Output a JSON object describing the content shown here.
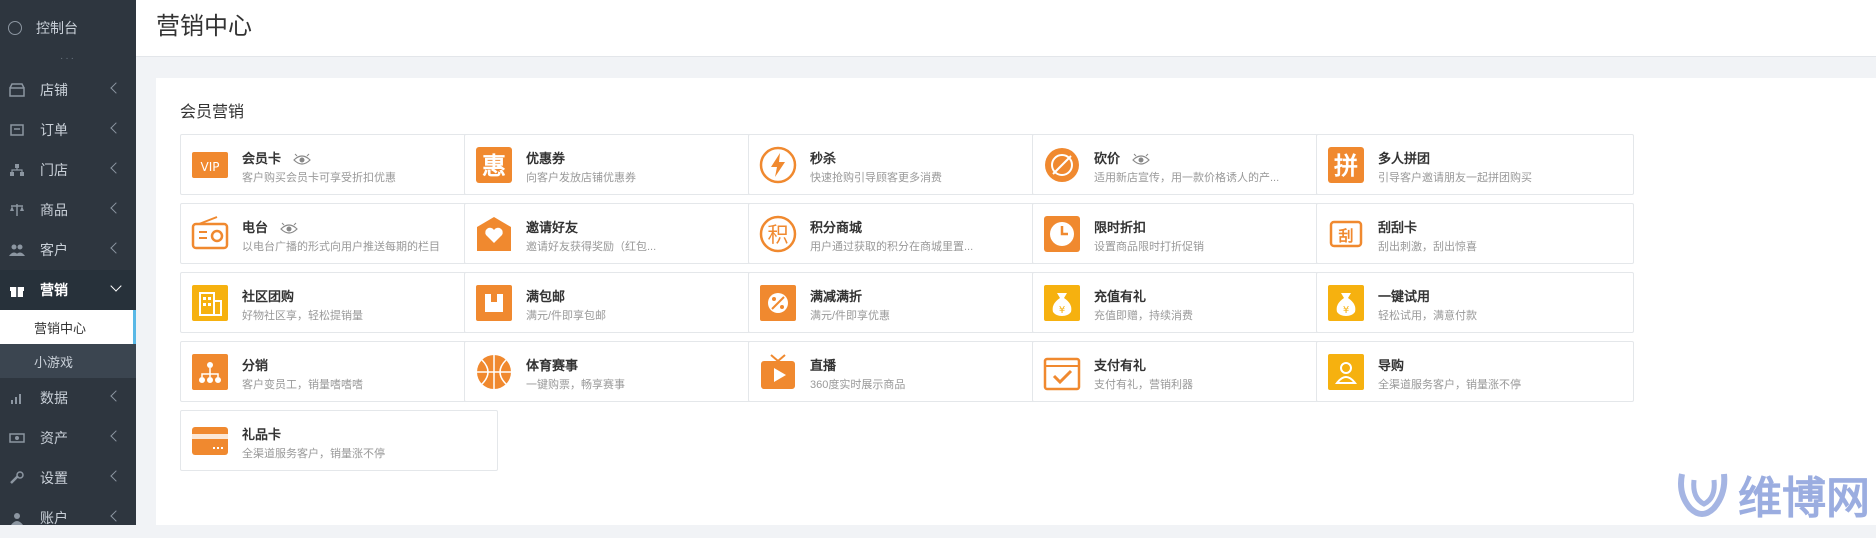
{
  "sidebar": {
    "dashboard": "控制台",
    "dots": "···",
    "items": [
      {
        "label": "店铺",
        "icon": "store-icon"
      },
      {
        "label": "订单",
        "icon": "order-icon"
      },
      {
        "label": "门店",
        "icon": "branch-icon"
      },
      {
        "label": "商品",
        "icon": "scale-icon"
      },
      {
        "label": "客户",
        "icon": "users-icon"
      },
      {
        "label": "营销",
        "icon": "gift-icon",
        "active": true
      },
      {
        "label": "数据",
        "icon": "bar-chart-icon"
      },
      {
        "label": "资产",
        "icon": "money-icon"
      },
      {
        "label": "设置",
        "icon": "wrench-icon"
      },
      {
        "label": "账户",
        "icon": "account-icon"
      }
    ],
    "submenu": [
      "营销中心",
      "小游戏"
    ]
  },
  "header": {
    "title": "营销中心"
  },
  "section": {
    "title": "会员营销"
  },
  "cards": [
    {
      "title": "会员卡",
      "desc": "客户购买会员卡可享受折扣优惠",
      "icon": "vip-icon",
      "eye": true
    },
    {
      "title": "优惠券",
      "desc": "向客户发放店铺优惠券",
      "icon": "coupon-icon",
      "glyph": "惠"
    },
    {
      "title": "秒杀",
      "desc": "快速抢购引导顾客更多消费",
      "icon": "lightning-icon"
    },
    {
      "title": "砍价",
      "desc": "适用新店宣传，用一款价格诱人的产...",
      "icon": "bargain-icon",
      "eye": true
    },
    {
      "title": "多人拼团",
      "desc": "引导客户邀请朋友一起拼团购买",
      "icon": "group-buy-icon",
      "glyph": "拼"
    },
    {
      "title": "电台",
      "desc": "以电台广播的形式向用户推送每期的栏目",
      "icon": "radio-icon",
      "eye": true
    },
    {
      "title": "邀请好友",
      "desc": "邀请好友获得奖励（红包...",
      "icon": "invite-icon"
    },
    {
      "title": "积分商城",
      "desc": "用户通过获取的积分在商城里置...",
      "icon": "points-icon",
      "glyph": "积"
    },
    {
      "title": "限时折扣",
      "desc": "设置商品限时打折促销",
      "icon": "clock-icon"
    },
    {
      "title": "刮刮卡",
      "desc": "刮出刺激，刮出惊喜",
      "icon": "scratch-card-icon",
      "glyph": "刮"
    },
    {
      "title": "社区团购",
      "desc": "好物社区享，轻松提销量",
      "icon": "building-icon"
    },
    {
      "title": "满包邮",
      "desc": "满元/件即享包邮",
      "icon": "package-icon"
    },
    {
      "title": "满减满折",
      "desc": "满元/件即享优惠",
      "icon": "percent-icon"
    },
    {
      "title": "充值有礼",
      "desc": "充值即赠，持续消费",
      "icon": "money-bag-icon"
    },
    {
      "title": "一键试用",
      "desc": "轻松试用，满意付款",
      "icon": "trial-bag-icon"
    },
    {
      "title": "分销",
      "desc": "客户变员工，销量嗜嗜嗜",
      "icon": "distribution-icon"
    },
    {
      "title": "体育赛事",
      "desc": "一键购票，畅享赛事",
      "icon": "basketball-icon"
    },
    {
      "title": "直播",
      "desc": "360度实时展示商品",
      "icon": "live-tv-icon"
    },
    {
      "title": "支付有礼",
      "desc": "支付有礼，营销利器",
      "icon": "pay-gift-icon"
    },
    {
      "title": "导购",
      "desc": "全渠道服务客户，销量涨不停",
      "icon": "guide-icon"
    },
    {
      "title": "礼品卡",
      "desc": "全渠道服务客户，销量涨不停",
      "icon": "gift-card-icon"
    }
  ],
  "watermark": {
    "text": "维博网"
  },
  "colors": {
    "orange": "#f0892f",
    "yellow": "#f6b10f",
    "sidebar": "#2e363f"
  }
}
